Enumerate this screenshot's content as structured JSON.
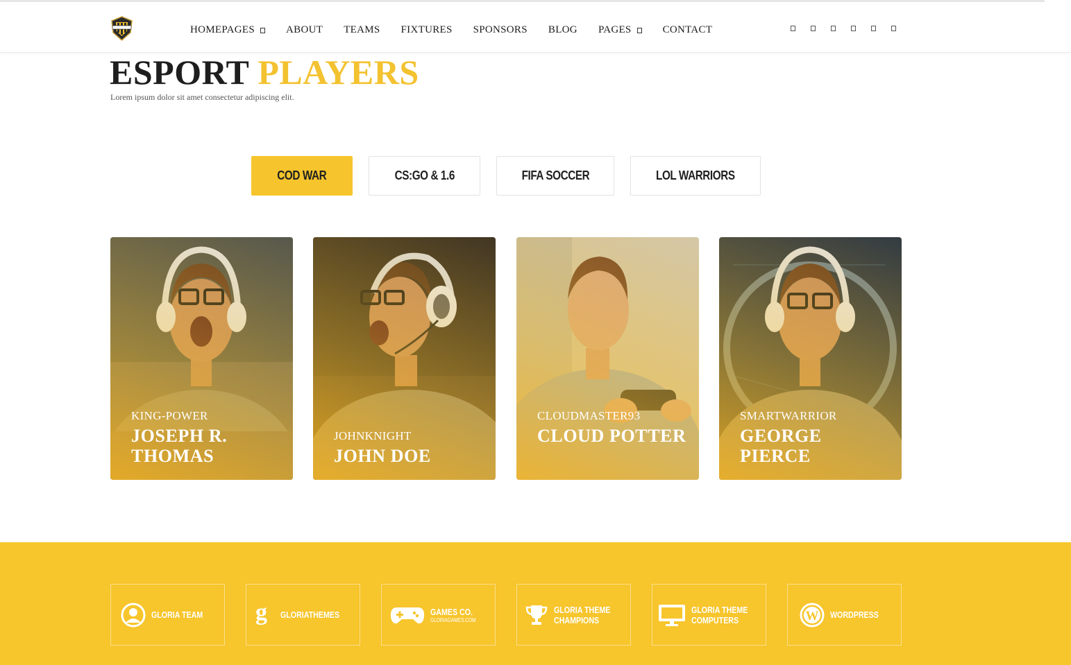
{
  "nav": {
    "items": [
      {
        "label": "HOMEPAGES",
        "has_dropdown": true
      },
      {
        "label": "ABOUT",
        "has_dropdown": false
      },
      {
        "label": "TEAMS",
        "has_dropdown": false
      },
      {
        "label": "FIXTURES",
        "has_dropdown": false
      },
      {
        "label": "SPONSORS",
        "has_dropdown": false
      },
      {
        "label": "BLOG",
        "has_dropdown": false
      },
      {
        "label": "PAGES",
        "has_dropdown": true
      },
      {
        "label": "CONTACT",
        "has_dropdown": false
      }
    ],
    "social_icons": [
      "facebook-icon",
      "twitter-icon",
      "instagram-icon",
      "youtube-icon",
      "twitch-icon",
      "discord-icon"
    ]
  },
  "heading": {
    "title_part1": "ESPORT",
    "title_part2": "PLAYERS",
    "subtitle": "Lorem ipsum dolor sit amet consectetur adipiscing elit."
  },
  "tabs": [
    {
      "label": "COD WAR",
      "active": true
    },
    {
      "label": "CS:GO & 1.6",
      "active": false
    },
    {
      "label": "FIFA SOCCER",
      "active": false
    },
    {
      "label": "LOL WARRIORS",
      "active": false
    }
  ],
  "players": [
    {
      "handle": "KING-POWER",
      "name": "JOSEPH R. THOMAS"
    },
    {
      "handle": "JOHNKNIGHT",
      "name": "JOHN DOE"
    },
    {
      "handle": "CLOUDMASTER93",
      "name": "CLOUD POTTER"
    },
    {
      "handle": "SMARTWARRIOR",
      "name": "GEORGE PIERCE"
    }
  ],
  "sponsors": [
    {
      "icon": "user-circle-icon",
      "line1": "GLORIA TEAM",
      "line2": ""
    },
    {
      "icon": "g-logo-icon",
      "line1": "GLORIATHEMES",
      "line2": ""
    },
    {
      "icon": "gamepad-icon",
      "line1": "GAMES CO.",
      "line2": "GLORIAGAMES.COM"
    },
    {
      "icon": "trophy-icon",
      "line1": "GLORIA THEME",
      "line2": "CHAMPIONS"
    },
    {
      "icon": "monitor-icon",
      "line1": "GLORIA THEME",
      "line2": "COMPUTERS"
    },
    {
      "icon": "wordpress-icon",
      "line1": "WORDPRESS",
      "line2": ""
    }
  ],
  "colors": {
    "accent": "#f6c42c",
    "dark": "#1e1e1e"
  }
}
